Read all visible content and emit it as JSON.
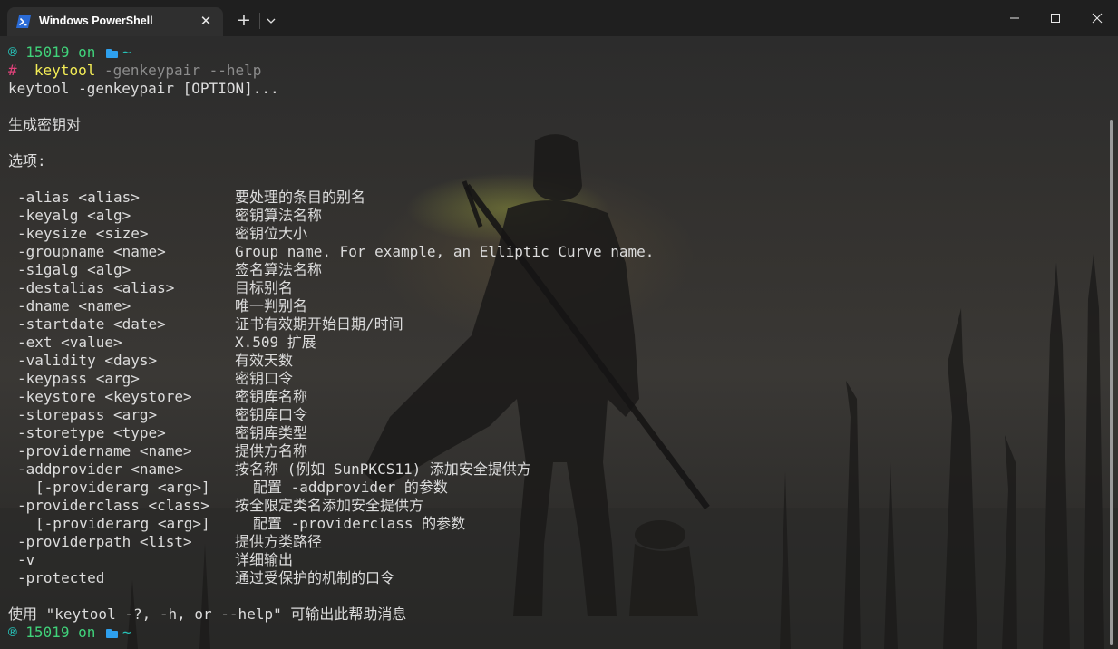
{
  "window": {
    "tab_title": "Windows PowerShell",
    "tab_icon": "powershell-icon",
    "close_tab_glyph": "✕",
    "new_tab_glyph": "+",
    "accent": "#2a6bd6"
  },
  "prompt": {
    "icon_glyph": "®",
    "user": "15019",
    "on": "on",
    "dir": "~",
    "hash": "#",
    "color_prompt": "#40d27a",
    "color_hash": "#e0427a"
  },
  "command": {
    "name": "keytool",
    "args": "-genkeypair --help"
  },
  "output": {
    "usage": "keytool -genkeypair [OPTION]...",
    "heading": "生成密钥对",
    "options_label": "选项:",
    "options": [
      {
        "opt": "-alias <alias>",
        "desc": "要处理的条目的别名",
        "indent": false
      },
      {
        "opt": "-keyalg <alg>",
        "desc": "密钥算法名称",
        "indent": false
      },
      {
        "opt": "-keysize <size>",
        "desc": "密钥位大小",
        "indent": false
      },
      {
        "opt": "-groupname <name>",
        "desc": "Group name. For example, an Elliptic Curve name.",
        "indent": false
      },
      {
        "opt": "-sigalg <alg>",
        "desc": "签名算法名称",
        "indent": false
      },
      {
        "opt": "-destalias <alias>",
        "desc": "目标别名",
        "indent": false
      },
      {
        "opt": "-dname <name>",
        "desc": "唯一判别名",
        "indent": false
      },
      {
        "opt": "-startdate <date>",
        "desc": "证书有效期开始日期/时间",
        "indent": false
      },
      {
        "opt": "-ext <value>",
        "desc": "X.509 扩展",
        "indent": false
      },
      {
        "opt": "-validity <days>",
        "desc": "有效天数",
        "indent": false
      },
      {
        "opt": "-keypass <arg>",
        "desc": "密钥口令",
        "indent": false
      },
      {
        "opt": "-keystore <keystore>",
        "desc": "密钥库名称",
        "indent": false
      },
      {
        "opt": "-storepass <arg>",
        "desc": "密钥库口令",
        "indent": false
      },
      {
        "opt": "-storetype <type>",
        "desc": "密钥库类型",
        "indent": false
      },
      {
        "opt": "-providername <name>",
        "desc": "提供方名称",
        "indent": false
      },
      {
        "opt": "-addprovider <name>",
        "desc": "按名称 (例如 SunPKCS11) 添加安全提供方",
        "indent": false
      },
      {
        "opt": "[-providerarg <arg>]",
        "desc": "配置 -addprovider 的参数",
        "indent": true
      },
      {
        "opt": "-providerclass <class>",
        "desc": "按全限定类名添加安全提供方",
        "indent": false
      },
      {
        "opt": "[-providerarg <arg>]",
        "desc": "配置 -providerclass 的参数",
        "indent": true
      },
      {
        "opt": "-providerpath <list>",
        "desc": "提供方类路径",
        "indent": false
      },
      {
        "opt": "-v",
        "desc": "详细输出",
        "indent": false
      },
      {
        "opt": "-protected",
        "desc": "通过受保护的机制的口令",
        "indent": false
      }
    ],
    "footer": "使用 \"keytool -?, -h, or --help\" 可输出此帮助消息"
  }
}
